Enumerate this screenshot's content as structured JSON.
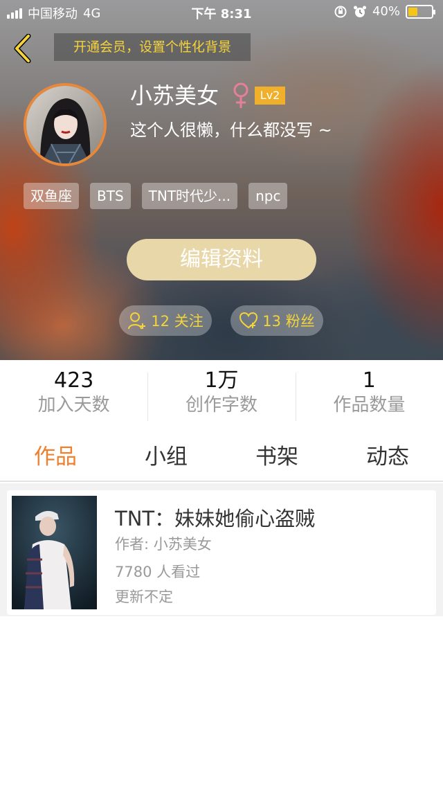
{
  "status_bar": {
    "carrier": "中国移动",
    "network": "4G",
    "time": "下午 8:31",
    "battery": "40%",
    "battery_level": 0.4
  },
  "header": {
    "vip_banner": "开通会员，设置个性化背景"
  },
  "profile": {
    "username": "小苏美女",
    "gender": "female",
    "level": "Lv2",
    "bio": "这个人很懒，什么都没写 ~",
    "tags": [
      "双鱼座",
      "BTS",
      "TNT时代少...",
      "npc"
    ],
    "edit_label": "编辑资料",
    "follows_label": "12 关注",
    "fans_label": "13 粉丝"
  },
  "stats": [
    {
      "value": "423",
      "label": "加入天数"
    },
    {
      "value": "1万",
      "label": "创作字数"
    },
    {
      "value": "1",
      "label": "作品数量"
    }
  ],
  "tabs": [
    {
      "label": "作品",
      "active": true
    },
    {
      "label": "小组",
      "active": false
    },
    {
      "label": "书架",
      "active": false
    },
    {
      "label": "动态",
      "active": false
    }
  ],
  "works": [
    {
      "title": "TNT：妹妹她偷心盗贼",
      "author": "作者: 小苏美女",
      "views": "7780 人看过",
      "update": "更新不定"
    }
  ],
  "colors": {
    "accent": "#f07f30",
    "gold": "#f5d33a",
    "level_badge": "#f0b02c",
    "edit_button": "#e8d7a8",
    "gender_icon": "#e67f9c"
  }
}
